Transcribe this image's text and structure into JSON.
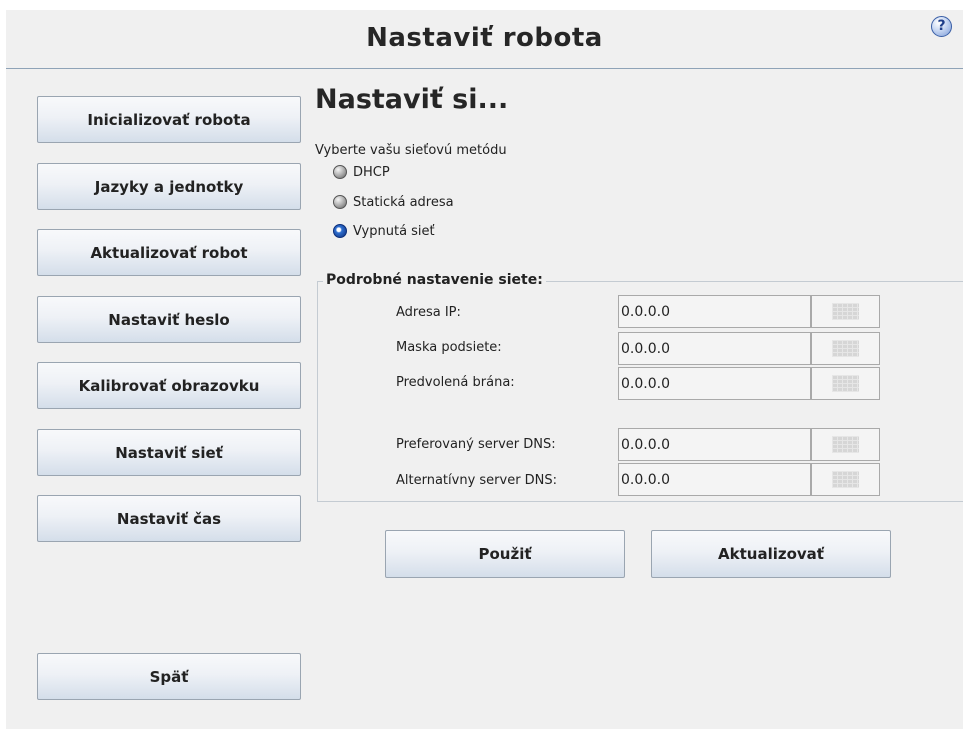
{
  "header": {
    "title": "Nastaviť robota",
    "help_icon": "question-mark-circle",
    "help_glyph": "?"
  },
  "sidebar": {
    "items": [
      {
        "label": "Inicializovať robota"
      },
      {
        "label": "Jazyky a jednotky"
      },
      {
        "label": "Aktualizovať robot"
      },
      {
        "label": "Nastaviť heslo"
      },
      {
        "label": "Kalibrovať obrazovku"
      },
      {
        "label": "Nastaviť sieť"
      },
      {
        "label": "Nastaviť čas"
      }
    ],
    "back_label": "Späť"
  },
  "main": {
    "section_title": "Nastaviť si...",
    "method_prompt": "Vyberte vašu sieťovú metódu",
    "methods": [
      {
        "label": "DHCP",
        "selected": false
      },
      {
        "label": "Statická adresa",
        "selected": false
      },
      {
        "label": "Vypnutá sieť",
        "selected": true
      }
    ],
    "details": {
      "legend": "Podrobné nastavenie siete:",
      "fields": [
        {
          "label": "Adresa IP:",
          "value": "0.0.0.0"
        },
        {
          "label": "Maska podsiete:",
          "value": "0.0.0.0"
        },
        {
          "label": "Predvolená brána:",
          "value": "0.0.0.0"
        },
        {
          "label": "Preferovaný server DNS:",
          "value": "0.0.0.0"
        },
        {
          "label": "Alternatívny server DNS:",
          "value": "0.0.0.0"
        }
      ],
      "keypad_icon": "keypad-icon"
    },
    "apply_label": "Použiť",
    "refresh_label": "Aktualizovať"
  },
  "colors": {
    "background": "#f0f0f0",
    "title_rule": "#8fa3b7",
    "button_gradient_bottom": "#d4deea",
    "selected_radio": "#2f6fd0"
  }
}
